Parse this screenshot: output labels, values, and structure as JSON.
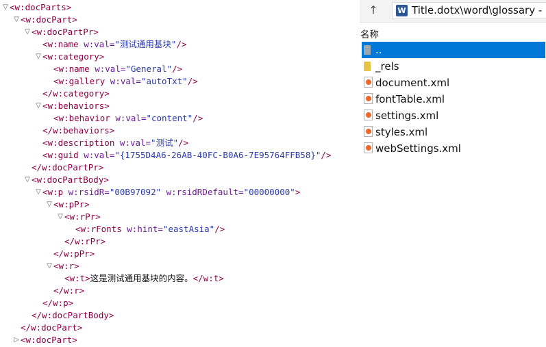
{
  "xml_tree": {
    "lines": [
      {
        "tri": "▽",
        "parts": [
          [
            "tag",
            "<w:docParts>"
          ]
        ]
      },
      {
        "tri": "▽",
        "parts": [
          [
            "tag",
            "<w:docPart>"
          ]
        ]
      },
      {
        "tri": "▽",
        "parts": [
          [
            "tag",
            "<w:docPartPr>"
          ]
        ]
      },
      {
        "tri": "",
        "parts": [
          [
            "tag",
            "<w:name "
          ],
          [
            "attr-name",
            "w:val="
          ],
          [
            "attr-val",
            "\"测试通用基块\""
          ],
          [
            "tag",
            "/>"
          ]
        ]
      },
      {
        "tri": "▽",
        "parts": [
          [
            "tag",
            "<w:category>"
          ]
        ]
      },
      {
        "tri": "",
        "parts": [
          [
            "tag",
            "<w:name "
          ],
          [
            "attr-name",
            "w:val="
          ],
          [
            "attr-val",
            "\"General\""
          ],
          [
            "tag",
            "/>"
          ]
        ]
      },
      {
        "tri": "",
        "parts": [
          [
            "tag",
            "<w:gallery "
          ],
          [
            "attr-name",
            "w:val="
          ],
          [
            "attr-val",
            "\"autoTxt\""
          ],
          [
            "tag",
            "/>"
          ]
        ]
      },
      {
        "tri": "",
        "parts": [
          [
            "tag",
            "</w:category>"
          ]
        ]
      },
      {
        "tri": "▽",
        "parts": [
          [
            "tag",
            "<w:behaviors>"
          ]
        ]
      },
      {
        "tri": "",
        "parts": [
          [
            "tag",
            "<w:behavior "
          ],
          [
            "attr-name",
            "w:val="
          ],
          [
            "attr-val",
            "\"content\""
          ],
          [
            "tag",
            "/>"
          ]
        ]
      },
      {
        "tri": "",
        "parts": [
          [
            "tag",
            "</w:behaviors>"
          ]
        ]
      },
      {
        "tri": "",
        "parts": [
          [
            "tag",
            "<w:description "
          ],
          [
            "attr-name",
            "w:val="
          ],
          [
            "attr-val",
            "\"测试\""
          ],
          [
            "tag",
            "/>"
          ]
        ]
      },
      {
        "tri": "",
        "parts": [
          [
            "tag",
            "<w:guid "
          ],
          [
            "attr-name",
            "w:val="
          ],
          [
            "attr-val",
            "\"{1755D4A6-26AB-40FC-B0A6-7E95764FFB58}\""
          ],
          [
            "tag",
            "/>"
          ]
        ]
      },
      {
        "tri": "",
        "parts": [
          [
            "tag",
            "</w:docPartPr>"
          ]
        ]
      },
      {
        "tri": "▽",
        "parts": [
          [
            "tag",
            "<w:docPartBody>"
          ]
        ]
      },
      {
        "tri": "▽",
        "parts": [
          [
            "tag",
            "<w:p "
          ],
          [
            "attr-name",
            "w:rsidR="
          ],
          [
            "attr-val",
            "\"00B97092\""
          ],
          [
            "attr-name",
            " w:rsidRDefault="
          ],
          [
            "attr-val",
            "\"00000000\""
          ],
          [
            "tag",
            ">"
          ]
        ]
      },
      {
        "tri": "▽",
        "parts": [
          [
            "tag",
            "<w:pPr>"
          ]
        ]
      },
      {
        "tri": "▽",
        "parts": [
          [
            "tag",
            "<w:rPr>"
          ]
        ]
      },
      {
        "tri": "",
        "parts": [
          [
            "tag",
            "<w:rFonts "
          ],
          [
            "attr-name",
            "w:hint="
          ],
          [
            "attr-val",
            "\"eastAsia\""
          ],
          [
            "tag",
            "/>"
          ]
        ]
      },
      {
        "tri": "",
        "parts": [
          [
            "tag",
            "</w:rPr>"
          ]
        ]
      },
      {
        "tri": "",
        "parts": [
          [
            "tag",
            "</w:pPr>"
          ]
        ]
      },
      {
        "tri": "▽",
        "parts": [
          [
            "tag",
            "<w:r>"
          ]
        ]
      },
      {
        "tri": "",
        "parts": [
          [
            "tag",
            "<w:t>"
          ],
          [
            "text-node",
            "这是测试通用基块的内容。"
          ],
          [
            "tag",
            "</w:t>"
          ]
        ]
      },
      {
        "tri": "",
        "parts": [
          [
            "tag",
            "</w:r>"
          ]
        ]
      },
      {
        "tri": "",
        "parts": [
          [
            "tag",
            "</w:p>"
          ]
        ]
      },
      {
        "tri": "",
        "parts": [
          [
            "tag",
            "</w:docPartBody>"
          ]
        ]
      },
      {
        "tri": "",
        "parts": [
          [
            "tag",
            "</w:docPart>"
          ]
        ]
      },
      {
        "tri": "▷",
        "parts": [
          [
            "tag",
            "<w:docPart>"
          ]
        ]
      }
    ]
  },
  "explorer": {
    "up_icon": "↑",
    "address_icon": "word-doc-icon",
    "address_icon_letter": "W",
    "address": "Title.dotx\\word\\glossary -",
    "column_header": "名称",
    "files": [
      {
        "name": "..",
        "icon": "folder-up-icon",
        "selected": true
      },
      {
        "name": "_rels",
        "icon": "folder-icon",
        "selected": false
      },
      {
        "name": "document.xml",
        "icon": "xml-file-icon",
        "selected": false
      },
      {
        "name": "fontTable.xml",
        "icon": "xml-file-icon",
        "selected": false
      },
      {
        "name": "settings.xml",
        "icon": "xml-file-icon",
        "selected": false
      },
      {
        "name": "styles.xml",
        "icon": "xml-file-icon",
        "selected": false
      },
      {
        "name": "webSettings.xml",
        "icon": "xml-file-icon",
        "selected": false
      }
    ]
  },
  "colors": {
    "selection": "#0078d7",
    "tag": "#8b0045",
    "attr_name": "#6b1a95",
    "attr_value": "#2b3aa8"
  }
}
